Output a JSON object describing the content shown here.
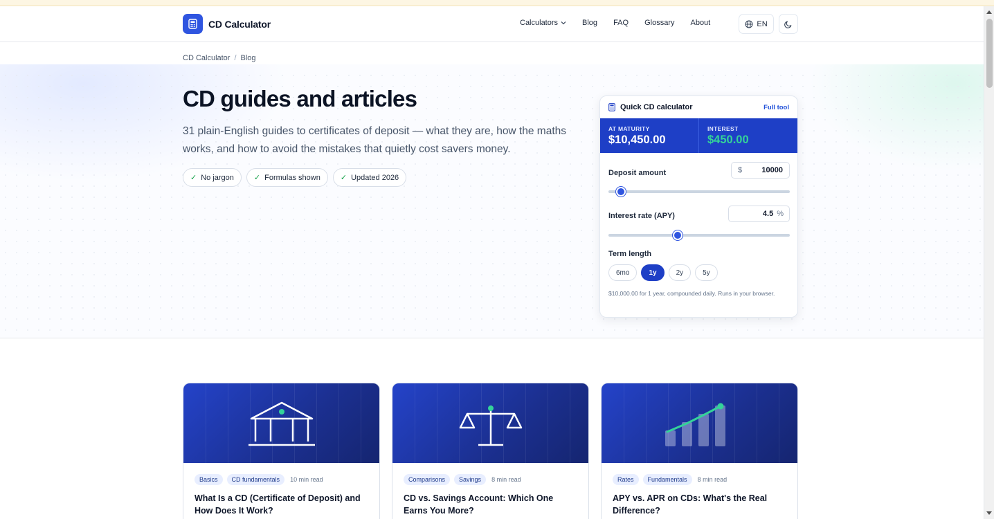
{
  "app": {
    "name": "CD Calculator"
  },
  "nav": {
    "items": [
      "Calculators",
      "Blog",
      "FAQ",
      "Glossary",
      "About"
    ],
    "language": "EN"
  },
  "breadcrumb": {
    "home": "CD Calculator",
    "separator": "/",
    "current": "Blog"
  },
  "hero": {
    "title": "CD guides and articles",
    "description": "31 plain-English guides to certificates of deposit — what they are, how the maths works, and how to avoid the mistakes that quietly cost savers money.",
    "pills": [
      "No jargon",
      "Formulas shown",
      "Updated 2026"
    ]
  },
  "calculator": {
    "title": "Quick CD calculator",
    "full_tool_link": "Full tool",
    "maturity_label": "AT MATURITY",
    "maturity_value": "$10,450.00",
    "interest_label": "INTEREST",
    "interest_value": "$450.00",
    "deposit_label": "Deposit amount",
    "deposit_prefix": "$",
    "deposit_value": "10000",
    "deposit_slider_fraction": 0.07,
    "rate_label": "Interest rate (APY)",
    "rate_value": "4.5",
    "rate_suffix": "%",
    "rate_slider_fraction": 0.38,
    "term_label": "Term length",
    "terms": [
      "6mo",
      "1y",
      "2y",
      "5y"
    ],
    "active_term": "1y",
    "note": "$10,000.00 for 1 year, compounded daily. Runs in your browser."
  },
  "articles": [
    {
      "tags": [
        "Basics",
        "CD fundamentals"
      ],
      "read_time": "10 min read",
      "title": "What Is a CD (Certificate of Deposit) and How Does It Work?",
      "icon": "bank-icon"
    },
    {
      "tags": [
        "Comparisons",
        "Savings"
      ],
      "read_time": "8 min read",
      "title": "CD vs. Savings Account: Which One Earns You More?",
      "icon": "scales-icon"
    },
    {
      "tags": [
        "Rates",
        "Fundamentals"
      ],
      "read_time": "8 min read",
      "title": "APY vs. APR on CDs: What's the Real Difference?",
      "icon": "growth-chart-icon"
    }
  ],
  "colors": {
    "brand": "#2f55e0",
    "stat_bar": "#1e3fc6",
    "accent_green": "#34d399"
  }
}
